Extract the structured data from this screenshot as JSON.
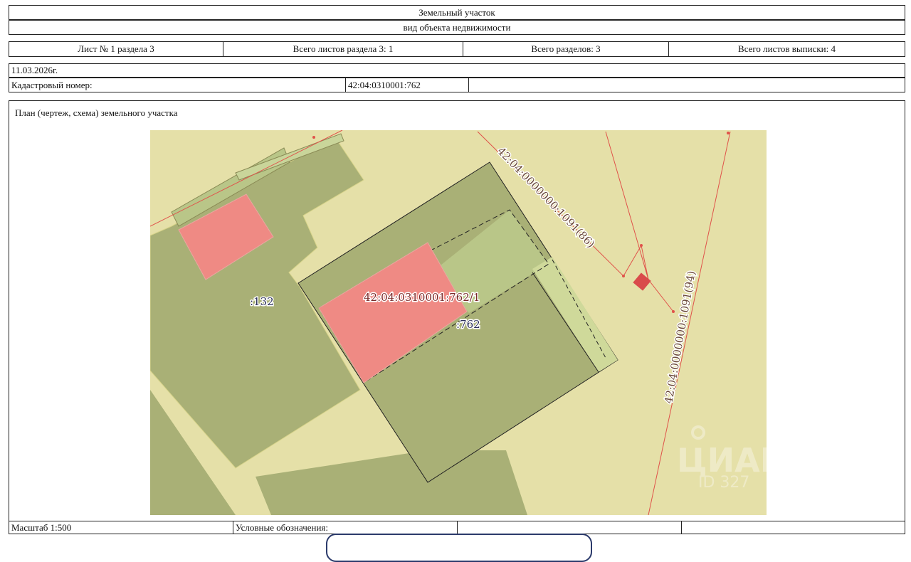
{
  "header": {
    "object_type": "Земельный участок",
    "object_type_caption": "вид объекта недвижимости"
  },
  "sheet_info": {
    "sheet": "Лист № 1 раздела 3",
    "sheets_in_section": "Всего листов раздела 3: 1",
    "sections_total": "Всего разделов: 3",
    "sheets_total": "Всего листов выписки: 4"
  },
  "date": "11.03.2026г.",
  "cadastral": {
    "label": "Кадастровый номер:",
    "value": "42:04:0310001:762"
  },
  "plan_title": "План (чертеж, схема) земельного участка",
  "map": {
    "labels": {
      "parcel_132": ":132",
      "parcel_762": ":762",
      "building": "42:04:0310001:762/1",
      "road_86": "42:04:0000000:1091(86)",
      "road_94": "42:04:0000000:1091(94)"
    },
    "watermark": {
      "brand": "ЦИАН",
      "id_text": "ID 327"
    },
    "colors": {
      "background": "#e5e0a8",
      "parcel_fill": "#a9b076",
      "building_fill": "#ef8a84",
      "light_green": "#b9c688",
      "boundary_line": "#e0524a",
      "marker": "#d94b4b"
    }
  },
  "footer": {
    "scale": "Масштаб 1:500",
    "legend": "Условные обозначения:",
    "col3": "",
    "col4": ""
  }
}
